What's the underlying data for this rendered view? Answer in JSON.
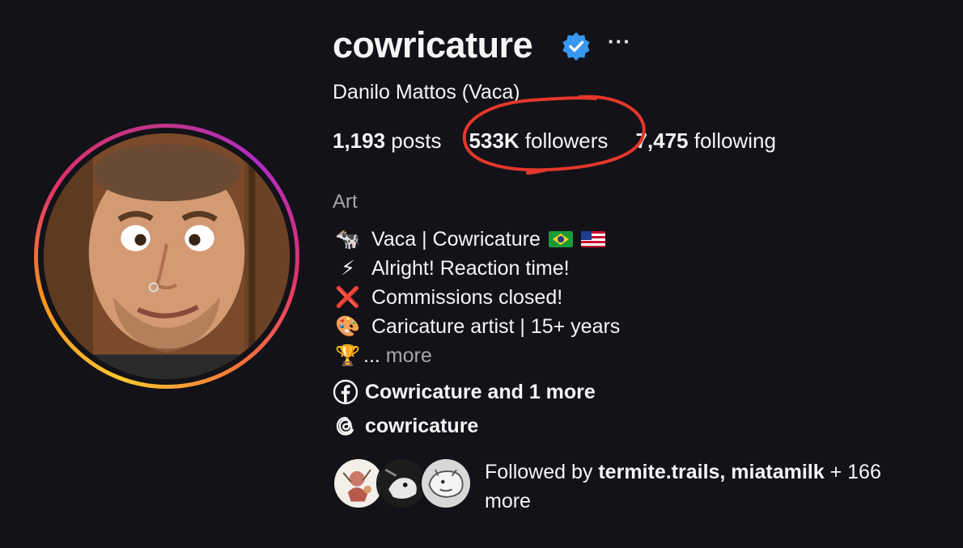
{
  "profile": {
    "username": "cowricature",
    "full_name": "Danilo Mattos (Vaca)",
    "category": "Art"
  },
  "stats": {
    "posts_count": "1,193",
    "posts_label": " posts",
    "followers_count": "533K",
    "followers_label": " followers",
    "following_count": "7,475",
    "following_label": " following"
  },
  "bio": {
    "line1_emoji": "🐄",
    "line1_text": "Vaca | Cowricature",
    "line2_emoji": "⚡",
    "line2_text": "Alright! Reaction time!",
    "line3_emoji": "❌",
    "line3_text": "Commissions closed!",
    "line4_emoji": "🎨",
    "line4_text": "Caricature artist | 15+ years",
    "line5_emoji": "🏆",
    "line5_prefix": "... ",
    "line5_more": "more"
  },
  "links": {
    "facebook_label": "Cowricature and 1 more",
    "threads_label": "cowricature"
  },
  "followed_by": {
    "prefix": "Followed by ",
    "names": "termite.trails, miatamilk",
    "suffix": " + 166 more"
  },
  "colors": {
    "background": "#121218",
    "verified_blue": "#3897f0",
    "annotation_red": "#e5372b",
    "muted_text": "#a8a8a8"
  },
  "icons": [
    "verified-badge-icon",
    "more-options-icon",
    "facebook-icon",
    "threads-icon"
  ]
}
